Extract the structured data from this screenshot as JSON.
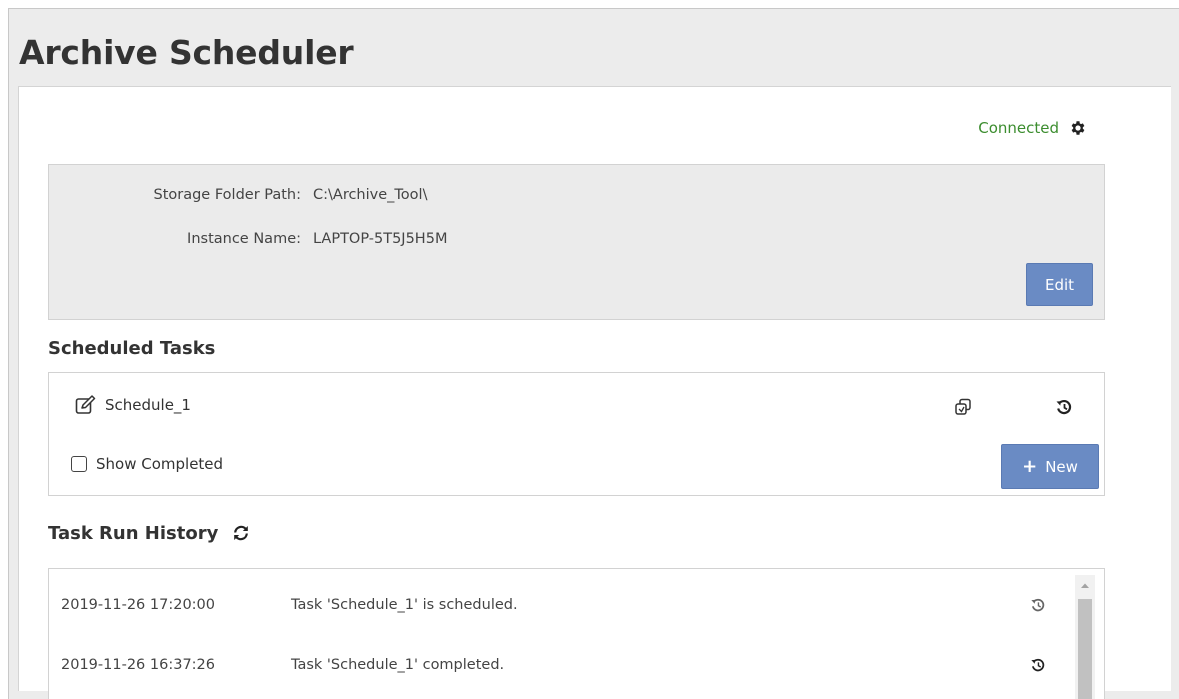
{
  "app": {
    "title": "Archive Scheduler"
  },
  "status": {
    "text": "Connected",
    "color": "#3c8d2f",
    "settings_icon": "gear-icon"
  },
  "settings": {
    "fields": [
      {
        "label": "Storage Folder Path:",
        "value": "C:\\Archive_Tool\\"
      },
      {
        "label": "Instance Name:",
        "value": "LAPTOP-5T5J5H5M"
      }
    ],
    "edit_label": "Edit"
  },
  "scheduled_tasks": {
    "title": "Scheduled Tasks",
    "items": [
      {
        "name": "Schedule_1",
        "icons": [
          "edit-icon",
          "copy-icon",
          "history-icon"
        ]
      }
    ],
    "show_completed_label": "Show Completed",
    "show_completed_checked": false,
    "new_button_label": "New"
  },
  "task_run_history": {
    "title": "Task Run History",
    "refresh_icon": "refresh-icon",
    "rows": [
      {
        "time": "2019-11-26 17:20:00",
        "message": "Task 'Schedule_1' is scheduled.",
        "icon": "history-icon"
      },
      {
        "time": "2019-11-26 16:37:26",
        "message": "Task 'Schedule_1' completed.",
        "icon": "history-icon"
      }
    ]
  },
  "colors": {
    "accent": "#6a8bc4",
    "panel_bg": "#ebebeb",
    "frame_bg": "#ececec"
  }
}
